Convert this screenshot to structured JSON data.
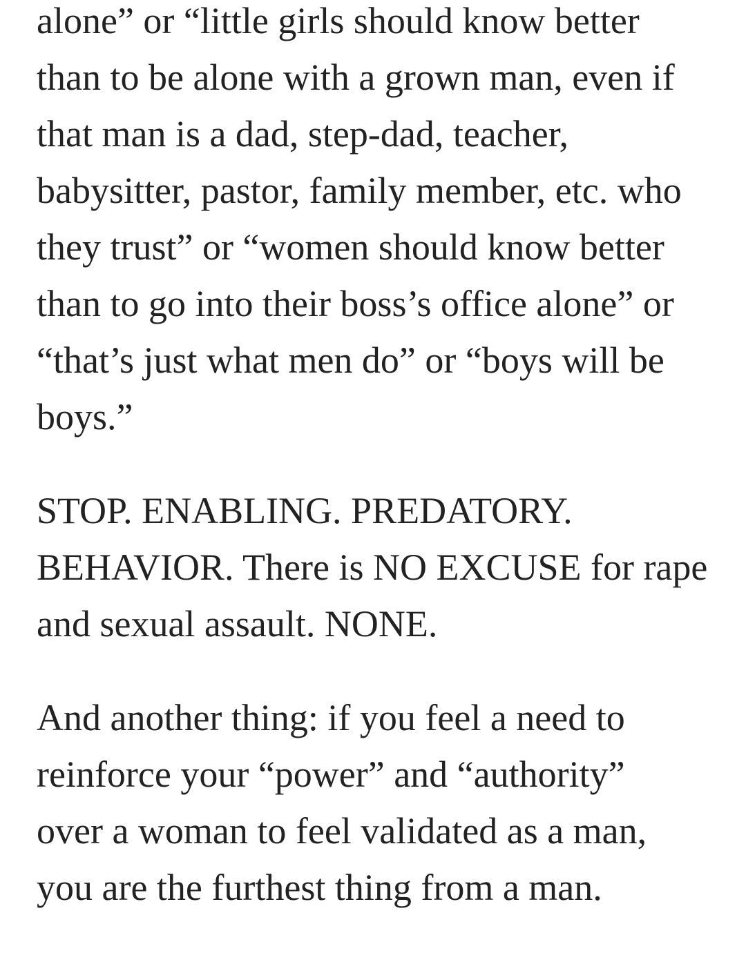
{
  "paragraphs": [
    {
      "lines": [
        "alone” or “little girls should know better",
        "than to be alone with a grown man, even if",
        "that man is a dad, step-dad, teacher,",
        "babysitter, pastor, family member, etc. who",
        "they trust” or “women should know better",
        "than to go into their boss’s office alone” or",
        "“that’s just what men do” or “boys will be",
        "boys.”"
      ]
    },
    {
      "lines": [
        "STOP. ENABLING. PREDATORY.",
        "BEHAVIOR. There is NO EXCUSE for rape",
        "and sexual assault. NONE."
      ]
    },
    {
      "lines": [
        "And another thing: if you feel a need to",
        "reinforce your “power” and “authority”",
        "over a woman to feel validated as a man,",
        "you are the furthest thing from a man."
      ]
    }
  ],
  "colors": {
    "text": "#222222",
    "background": "#ffffff"
  }
}
